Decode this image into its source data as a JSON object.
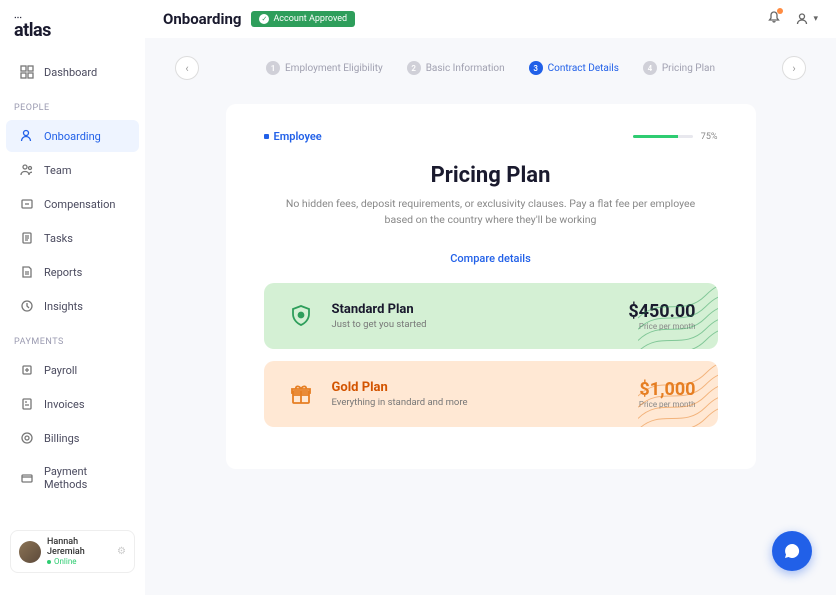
{
  "brand": "atlas",
  "header": {
    "title": "Onboarding",
    "badge": "Account Approved"
  },
  "nav": {
    "dashboard": "Dashboard",
    "section_people": "PEOPLE",
    "onboarding": "Onboarding",
    "team": "Team",
    "compensation": "Compensation",
    "tasks": "Tasks",
    "reports": "Reports",
    "insights": "Insights",
    "section_payments": "PAYMENTS",
    "payroll": "Payroll",
    "invoices": "Invoices",
    "billings": "Billings",
    "payment_methods": "Payment Methods"
  },
  "user": {
    "name": "Hannah Jeremiah",
    "status": "Online"
  },
  "stepper": {
    "s1": "Employment Eligibility",
    "s2": "Basic Information",
    "s3": "Contract Details",
    "s4": "Pricing Plan"
  },
  "card": {
    "tag": "Employee",
    "progress": "75%",
    "title": "Pricing Plan",
    "subtitle": "No hidden fees, deposit requirements, or exclusivity clauses. Pay a flat fee per employee based on the country where they'll be working",
    "compare": "Compare details"
  },
  "plans": {
    "standard": {
      "name": "Standard Plan",
      "desc": "Just to get you started",
      "price": "$450.00",
      "per": "Price per month"
    },
    "gold": {
      "name": "Gold Plan",
      "desc": "Everything in standard and more",
      "price": "$1,000",
      "per": "Price per month"
    }
  }
}
